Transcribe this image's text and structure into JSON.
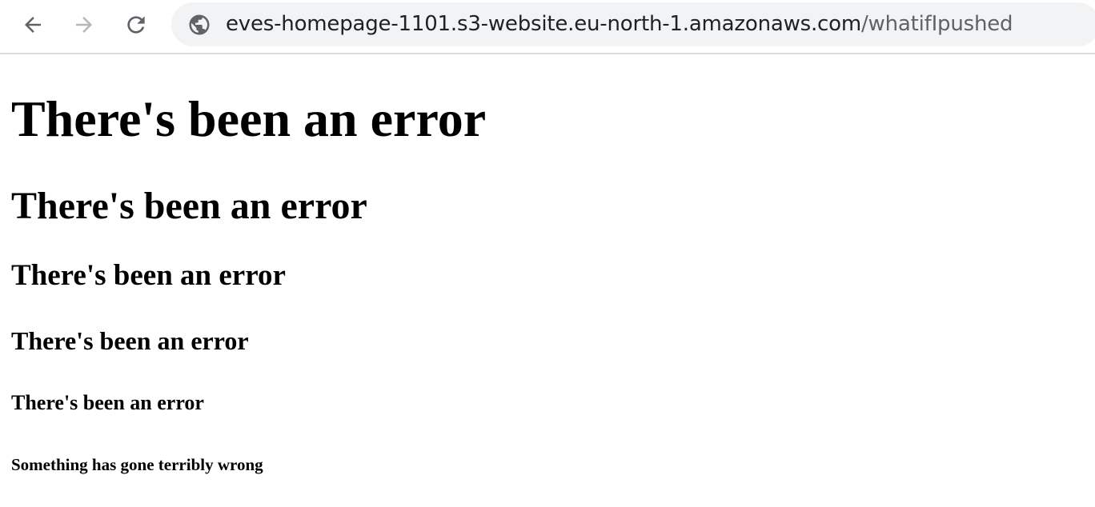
{
  "browser": {
    "back_icon": "arrow-left-icon",
    "forward_icon": "arrow-right-icon",
    "reload_icon": "reload-icon",
    "site_info_icon": "globe-icon",
    "url_host": "eves-homepage-1101.s3-website.eu-north-1.amazonaws.com",
    "url_path": "/whatifIpushed"
  },
  "page": {
    "heading_1": "There's been an error",
    "heading_2": "There's been an error",
    "heading_3": "There's been an error",
    "heading_4": "There's been an error",
    "heading_5": "There's been an error",
    "heading_6": "Something has gone terribly wrong"
  },
  "colors": {
    "toolbar_border": "#dadce0",
    "omnibox_bg": "#f1f3f4",
    "icon_active": "#5f6368",
    "icon_disabled": "#b4b7bb",
    "text": "#000000"
  }
}
